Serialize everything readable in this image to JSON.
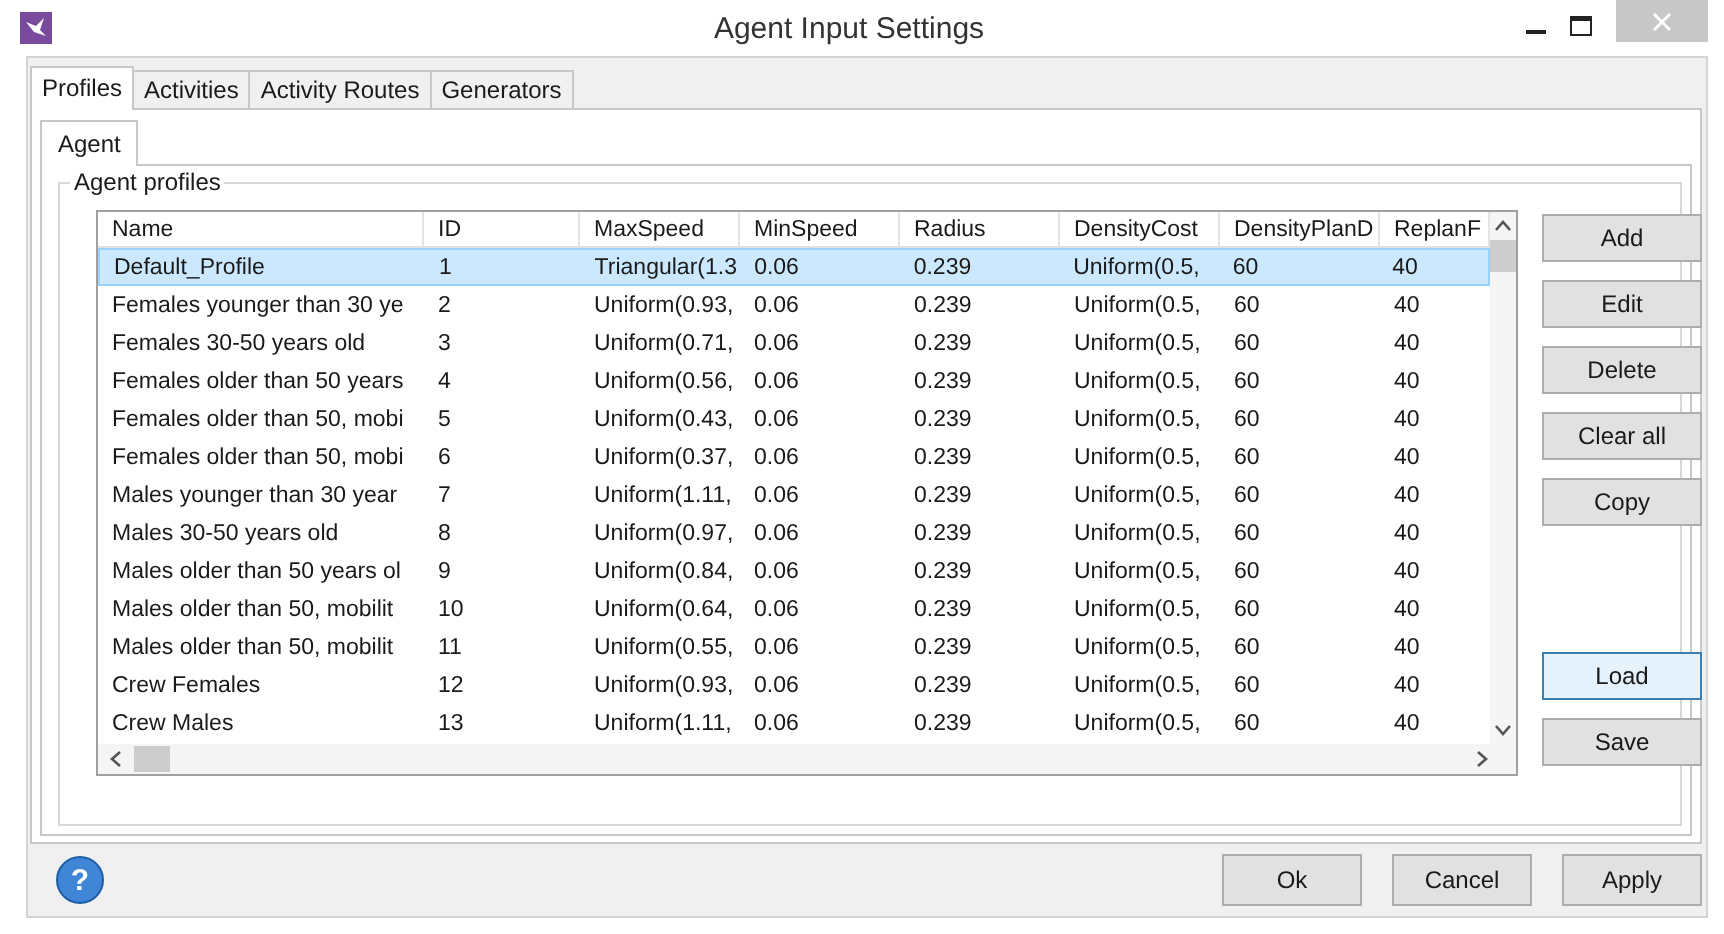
{
  "window": {
    "title": "Agent Input Settings"
  },
  "tabs": [
    {
      "label": "Profiles",
      "selected": true
    },
    {
      "label": "Activities",
      "selected": false
    },
    {
      "label": "Activity Routes",
      "selected": false
    },
    {
      "label": "Generators",
      "selected": false
    }
  ],
  "subtabs": [
    {
      "label": "Agent",
      "selected": true
    }
  ],
  "group": {
    "title": "Agent profiles"
  },
  "table": {
    "columns": [
      "Name",
      "ID",
      "MaxSpeed",
      "MinSpeed",
      "Radius",
      "DensityCost",
      "DensityPlanD",
      "ReplanF"
    ],
    "rows": [
      {
        "cells": [
          "Default_Profile",
          "1",
          "Triangular(1.3",
          "0.06",
          "0.239",
          "Uniform(0.5,",
          "60",
          "40"
        ],
        "selected": true
      },
      {
        "cells": [
          "Females younger than 30 ye",
          "2",
          "Uniform(0.93,",
          "0.06",
          "0.239",
          "Uniform(0.5,",
          "60",
          "40"
        ],
        "selected": false
      },
      {
        "cells": [
          "Females 30-50 years old",
          "3",
          "Uniform(0.71,",
          "0.06",
          "0.239",
          "Uniform(0.5,",
          "60",
          "40"
        ],
        "selected": false
      },
      {
        "cells": [
          "Females older than 50 years",
          "4",
          "Uniform(0.56,",
          "0.06",
          "0.239",
          "Uniform(0.5,",
          "60",
          "40"
        ],
        "selected": false
      },
      {
        "cells": [
          "Females older than 50, mobi",
          "5",
          "Uniform(0.43,",
          "0.06",
          "0.239",
          "Uniform(0.5,",
          "60",
          "40"
        ],
        "selected": false
      },
      {
        "cells": [
          "Females older than 50, mobi",
          "6",
          "Uniform(0.37,",
          "0.06",
          "0.239",
          "Uniform(0.5,",
          "60",
          "40"
        ],
        "selected": false
      },
      {
        "cells": [
          "Males younger than 30 year",
          "7",
          "Uniform(1.11,",
          "0.06",
          "0.239",
          "Uniform(0.5,",
          "60",
          "40"
        ],
        "selected": false
      },
      {
        "cells": [
          "Males 30-50 years old",
          "8",
          "Uniform(0.97,",
          "0.06",
          "0.239",
          "Uniform(0.5,",
          "60",
          "40"
        ],
        "selected": false
      },
      {
        "cells": [
          "Males older than 50 years ol",
          "9",
          "Uniform(0.84,",
          "0.06",
          "0.239",
          "Uniform(0.5,",
          "60",
          "40"
        ],
        "selected": false
      },
      {
        "cells": [
          "Males older than 50, mobilit",
          "10",
          "Uniform(0.64,",
          "0.06",
          "0.239",
          "Uniform(0.5,",
          "60",
          "40"
        ],
        "selected": false
      },
      {
        "cells": [
          "Males older than 50, mobilit",
          "11",
          "Uniform(0.55,",
          "0.06",
          "0.239",
          "Uniform(0.5,",
          "60",
          "40"
        ],
        "selected": false
      },
      {
        "cells": [
          "Crew Females",
          "12",
          "Uniform(0.93,",
          "0.06",
          "0.239",
          "Uniform(0.5,",
          "60",
          "40"
        ],
        "selected": false
      },
      {
        "cells": [
          "Crew Males",
          "13",
          "Uniform(1.11,",
          "0.06",
          "0.239",
          "Uniform(0.5,",
          "60",
          "40"
        ],
        "selected": false
      }
    ]
  },
  "side_buttons": [
    {
      "label": "Add",
      "focused": false
    },
    {
      "label": "Edit",
      "focused": false
    },
    {
      "label": "Delete",
      "focused": false
    },
    {
      "label": "Clear all",
      "focused": false
    },
    {
      "label": "Copy",
      "focused": false
    },
    {
      "label": "Load",
      "focused": true
    },
    {
      "label": "Save",
      "focused": false
    }
  ],
  "help_button": {
    "glyph": "?"
  },
  "footer_buttons": [
    {
      "label": "Ok"
    },
    {
      "label": "Cancel"
    },
    {
      "label": "Apply"
    }
  ]
}
